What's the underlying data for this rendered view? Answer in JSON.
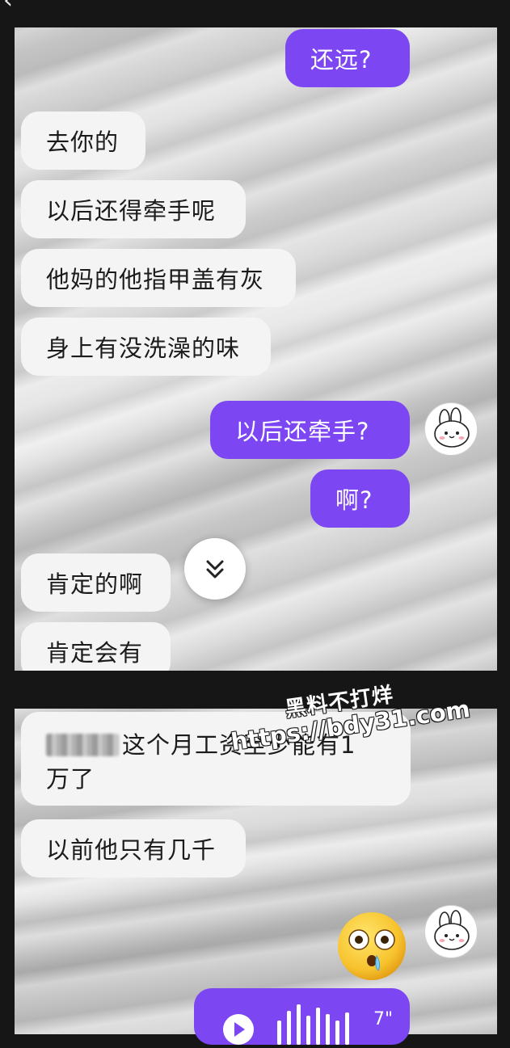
{
  "header": {
    "back_glyph": "‹"
  },
  "screenshot1": {
    "messages": [
      {
        "side": "sent",
        "text": "还远?"
      },
      {
        "side": "received",
        "text": "去你的"
      },
      {
        "side": "received",
        "text": "以后还得牵手呢"
      },
      {
        "side": "received",
        "text": "他妈的他指甲盖有灰"
      },
      {
        "side": "received",
        "text": "身上有没洗澡的味"
      },
      {
        "side": "sent",
        "text": "以后还牵手?"
      },
      {
        "side": "sent",
        "text": "啊?"
      },
      {
        "side": "received",
        "text": "肯定的啊"
      },
      {
        "side": "received",
        "text": "肯定会有"
      }
    ],
    "scroll_button_icon": "double-chevron-down-icon",
    "avatar_icon": "bunny-avatar-icon"
  },
  "screenshot2": {
    "messages": [
      {
        "side": "received",
        "text": "这个月工资至少能有1万了",
        "line1": "这个月工资至少能有1",
        "line2": "万了",
        "prefix_redacted": true
      },
      {
        "side": "received",
        "text": "以前他只有几千"
      },
      {
        "side": "sent",
        "type": "emoji",
        "icon": "shocked-crying-emoji-icon"
      },
      {
        "side": "sent",
        "type": "voice",
        "duration": "7\""
      }
    ],
    "avatar_icon": "bunny-avatar-icon"
  },
  "watermark": {
    "line1": "黑料不打烊",
    "line2": "https://bdy31.com"
  },
  "colors": {
    "sent_bubble": "#7c46f3",
    "received_bubble": "#f4f4f4",
    "background": "#161616"
  }
}
